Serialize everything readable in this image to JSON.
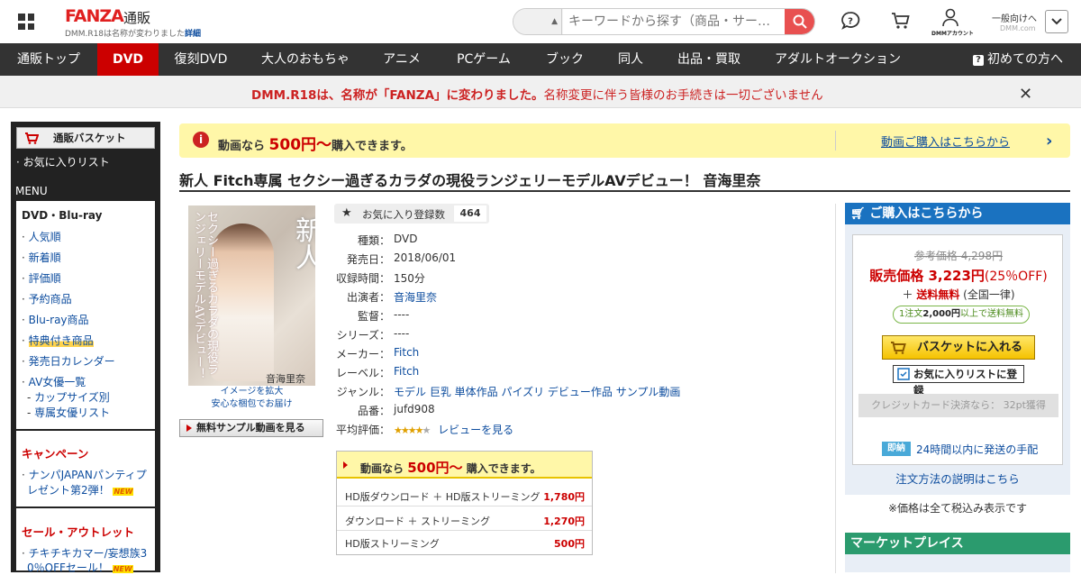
{
  "header": {
    "logo": "FANZA",
    "logo_sub": "通販",
    "logo_note": "DMM.R18は名称が変わりました",
    "logo_note_link": "詳細",
    "search_placeholder": "キーワードから探す（商品・サー…",
    "account_label": "DMMアカウント",
    "general": "一般向けへ",
    "general_sub": "DMM.com"
  },
  "nav": {
    "items": [
      "通販トップ",
      "DVD",
      "復刻DVD",
      "大人のおもちゃ",
      "アニメ",
      "PCゲーム",
      "ブック",
      "同人",
      "出品・買取",
      "アダルトオークション"
    ],
    "active": "DVD",
    "help": "初めての方へ"
  },
  "notice": {
    "bold": "DMM.R18は、名称が「FANZA」に変わりました。",
    "rest": "名称変更に伴う皆様のお手続きは一切ございません",
    "close": "✕"
  },
  "sidebar": {
    "basket": "通販バスケット",
    "favorites": "お気に入りリスト",
    "menu_title": "MENU",
    "category": "DVD・Blu-ray",
    "links": [
      "人気順",
      "新着順",
      "評価順",
      "予約商品",
      "Blu-ray商品",
      "特典付き商品",
      "発売日カレンダー",
      "AV女優一覧"
    ],
    "sublinks": [
      "カップサイズ別",
      "専属女優リスト"
    ],
    "campaign_title": "キャンペーン",
    "campaign_link_1": "ナンパJAPANパンティプ",
    "campaign_link_2": "レゼント第2弾！",
    "sale_title": "セール・アウトレット",
    "sale_link": "チキチキカマー/妄想族3",
    "sale_link_2": "0％OFFセール！",
    "new_badge": "NEW"
  },
  "banner": {
    "info": "i",
    "pre": "動画なら",
    "price": "500円〜",
    "post": "購入できます。",
    "link": "動画ご購入はこちらから"
  },
  "product": {
    "title": "新人 Fitch専属 セクシー過ぎるカラダの現役ランジェリーモデルAVデビュー！ 音海里奈",
    "cover_big": "新人",
    "cover_left": "セクシー過ぎるカラダの現役ランジェリーモデルAVデビュー！",
    "cover_name": "音海里奈",
    "cover_caption_1": "イメージを拡大",
    "cover_caption_2": "安心な梱包でお届け",
    "sample_button": "無料サンプル動画を見る",
    "fav_label": "お気に入り登録数",
    "fav_count": "464",
    "specs": [
      {
        "k": "種類：",
        "v": "DVD"
      },
      {
        "k": "発売日：",
        "v": "2018/06/01"
      },
      {
        "k": "収録時間：",
        "v": "150分"
      },
      {
        "k": "出演者：",
        "v": "音海里奈",
        "link": true
      },
      {
        "k": "監督：",
        "v": "----"
      },
      {
        "k": "シリーズ：",
        "v": "----"
      },
      {
        "k": "メーカー：",
        "v": "Fitch",
        "link": true
      },
      {
        "k": "レーベル：",
        "v": "Fitch",
        "link": true
      },
      {
        "k": "ジャンル：",
        "v": "モデル 巨乳 単体作品 パイズリ デビュー作品 サンプル動画",
        "link": true
      },
      {
        "k": "品番：",
        "v": "jufd908"
      }
    ],
    "rating_label": "平均評価：",
    "rating_stars": 4,
    "review_link": "レビューを見る"
  },
  "offer": {
    "pre": "動画なら",
    "price": "500円〜",
    "post": "購入できます。",
    "rows": [
      {
        "name": "HD版ダウンロード ＋ HD版ストリーミング",
        "price": "1,780円"
      },
      {
        "name": "ダウンロード ＋ ストリーミング",
        "price": "1,270円"
      },
      {
        "name": "HD版ストリーミング",
        "price": "500円"
      }
    ]
  },
  "purchase": {
    "title": "ご購入はこちらから",
    "ref_price": "参考価格 4,298円",
    "sale_label": "販売価格",
    "sale_price": "3,223円",
    "discount": "(25％OFF)",
    "ship_plus": "＋",
    "ship_free": "送料無料",
    "ship_note": "(全国一律)",
    "free_pre": "1注文",
    "free_amount": "2,000円",
    "free_post": "以上で送料無料",
    "cart": "バスケットに入れる",
    "wishlist": "お気に入りリストに登録",
    "credit": "クレジットカード決済なら： 32pt獲得",
    "sokunou": "即納",
    "ship_time": "24時間以内に発送の手配",
    "order_link": "注文方法の説明はこちら",
    "tax": "※価格は全て税込み表示です",
    "market": "マーケットプレイス"
  },
  "colors": {
    "accent": "#cc0000",
    "nav_bg": "#333333",
    "link": "#0c4c9e",
    "purchase_bar": "#1a72c0",
    "market_bar": "#2b9b6e"
  }
}
